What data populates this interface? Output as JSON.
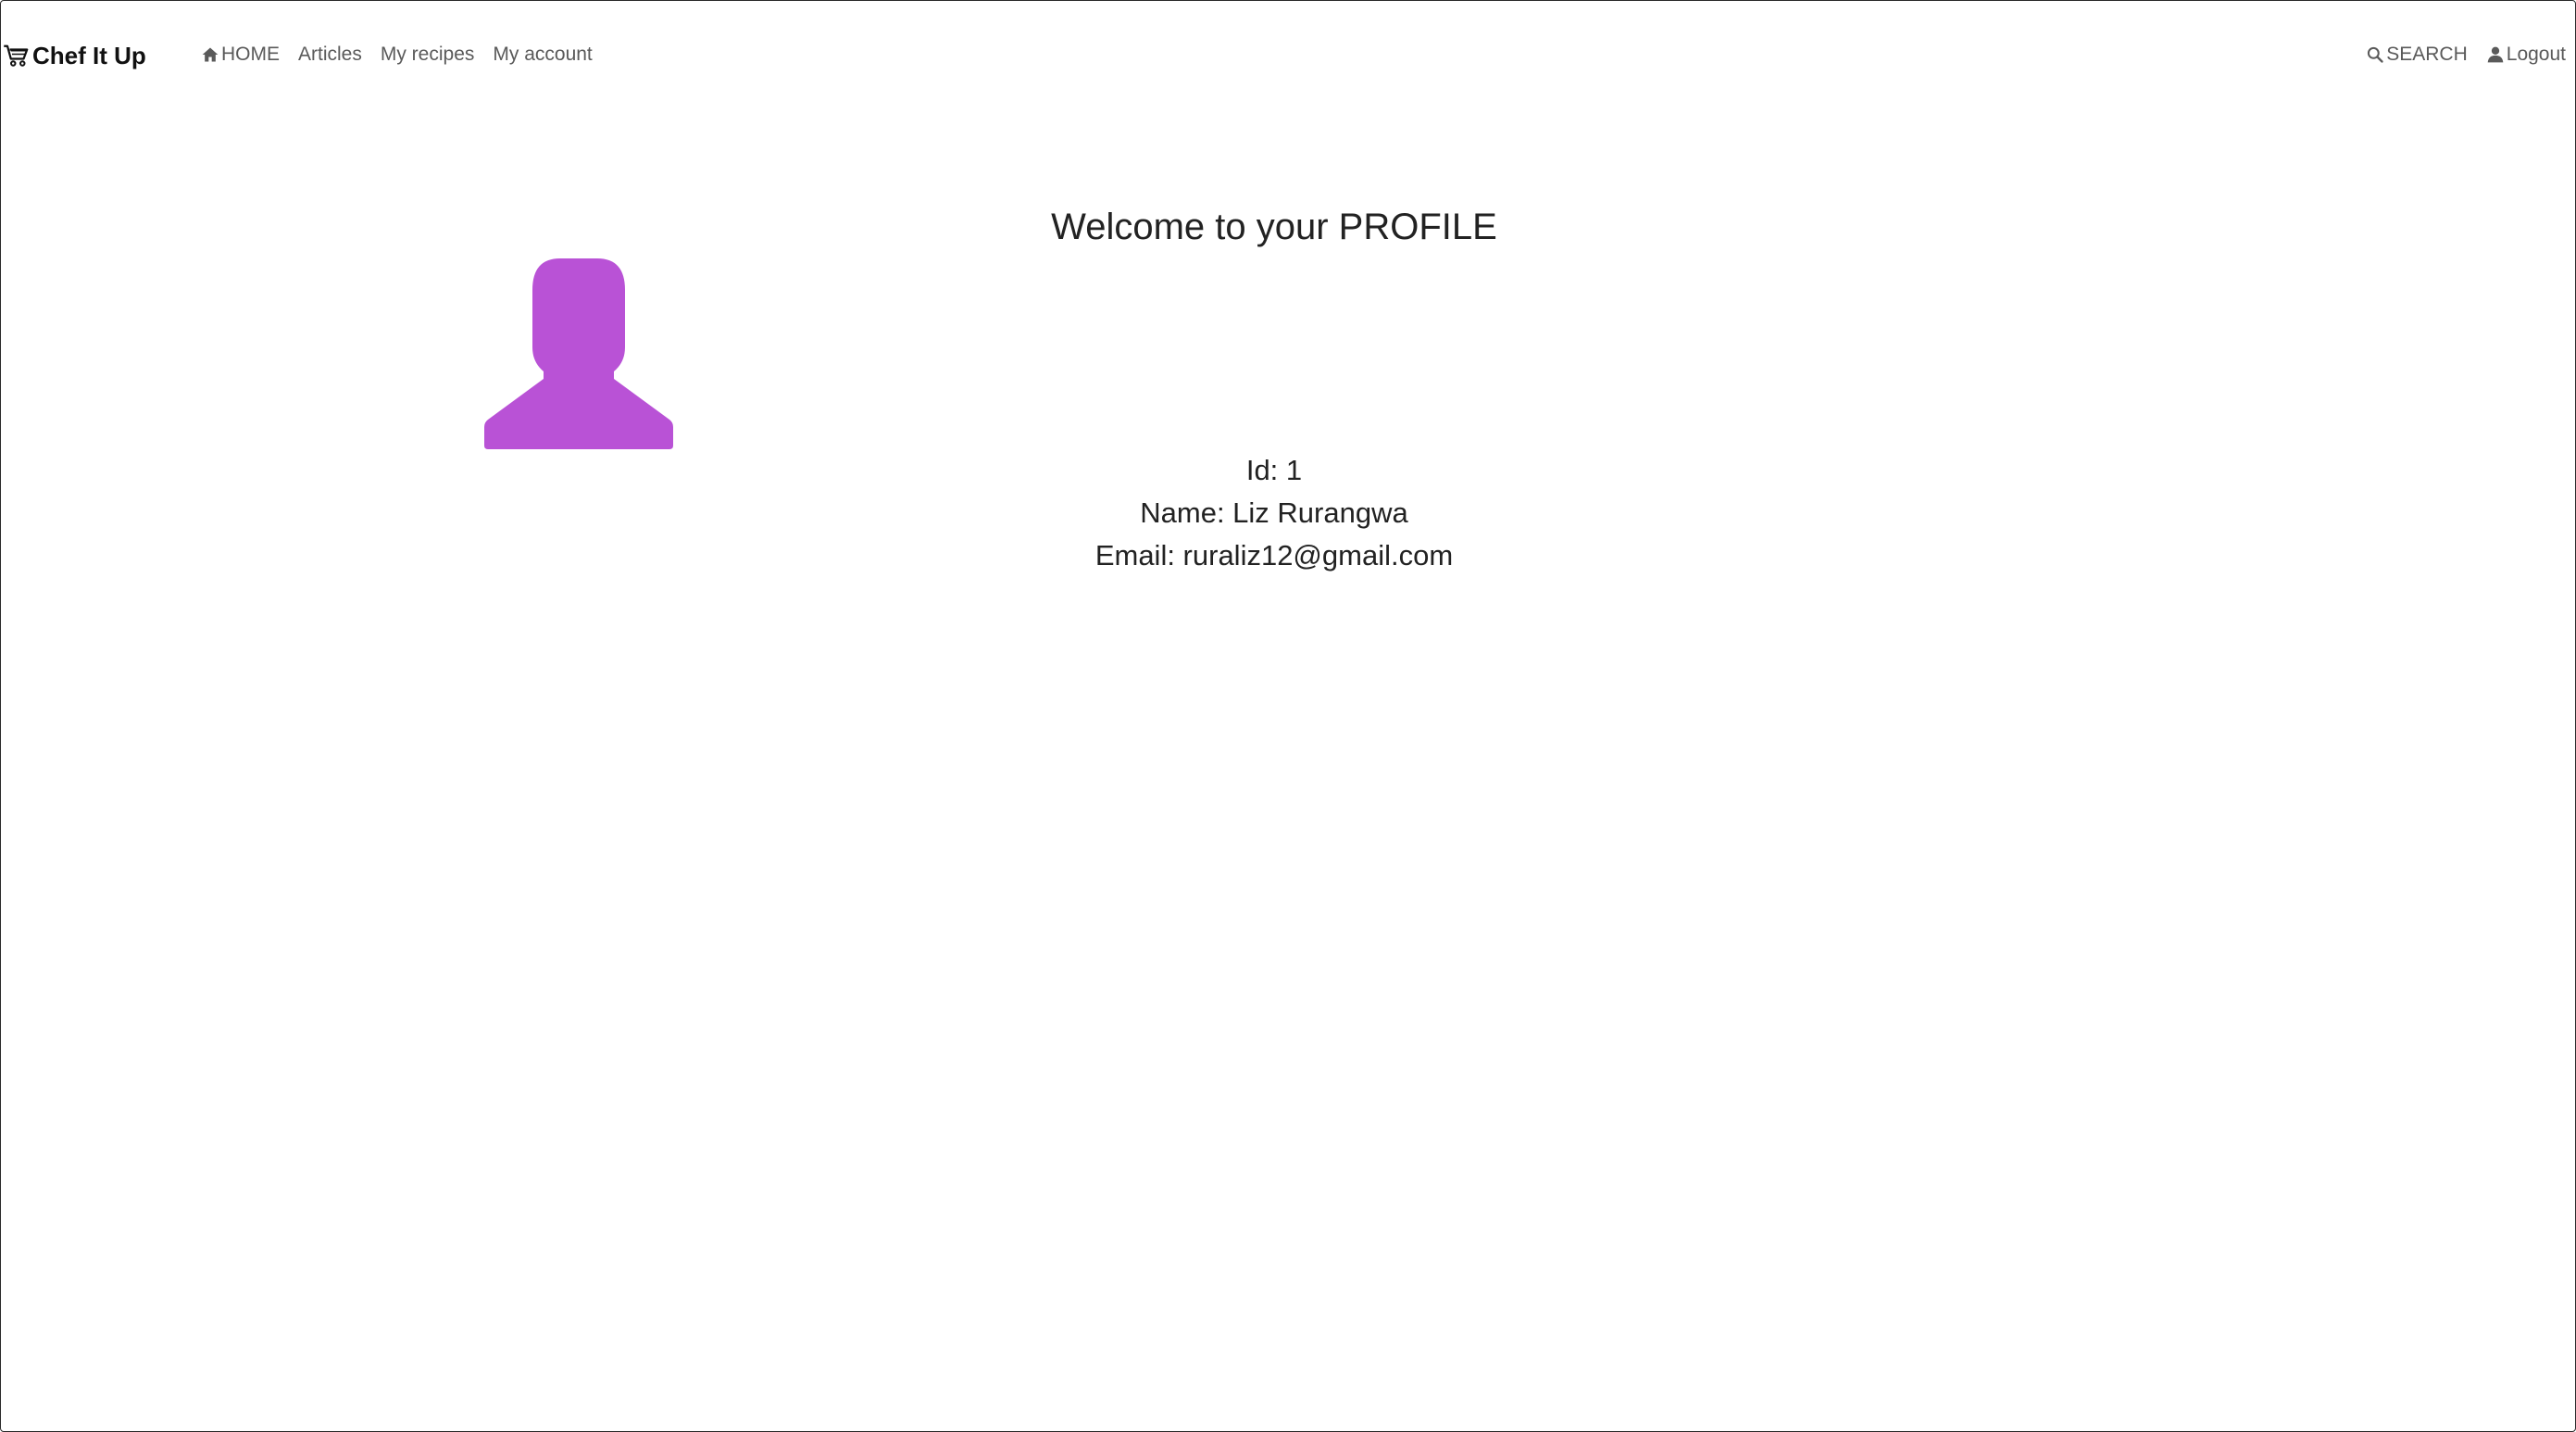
{
  "navbar": {
    "brand": "Chef It Up",
    "links": {
      "home": "HOME",
      "articles": "Articles",
      "my_recipes": "My recipes",
      "my_account": "My account"
    },
    "right": {
      "search": "SEARCH",
      "logout": "Logout"
    }
  },
  "profile": {
    "title": "Welcome to your PROFILE",
    "id_line": "Id: 1",
    "name_line": "Name: Liz Rurangwa",
    "email_line": "Email: ruraliz12@gmail.com",
    "avatar_icon": "person-silhouette-icon",
    "avatar_color": "#b952d6"
  }
}
